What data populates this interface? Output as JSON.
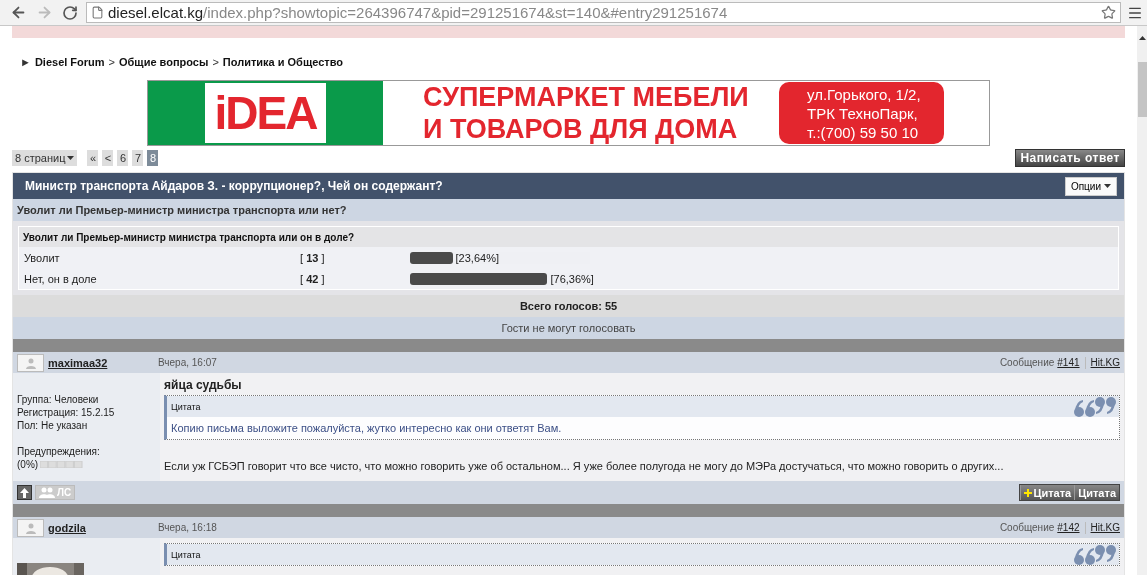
{
  "browser": {
    "url_host": "diesel.elcat.kg",
    "url_path": "/index.php?showtopic=264396747&pid=291251674&st=140&#entry291251674",
    "forward_disabled": true
  },
  "breadcrumb": {
    "marker": "►",
    "separator": ">",
    "items": [
      "Diesel Forum",
      "Общие вопросы",
      "Политика и Общество"
    ]
  },
  "banner": {
    "logo": "iDEA",
    "headline": [
      "СУПЕРМАРКЕТ МЕБЕЛИ",
      "И ТОВАРОВ ДЛЯ ДОМА"
    ],
    "address": [
      "ул.Горького, 1/2,",
      "ТРК ТехноПарк,",
      "т.:(700) 59 50 10"
    ]
  },
  "pagination": {
    "pages_label": "8 страниц",
    "buttons": [
      {
        "label": "«",
        "selected": false
      },
      {
        "label": "<",
        "selected": false
      },
      {
        "label": "6",
        "selected": false
      },
      {
        "label": "7",
        "selected": false
      },
      {
        "label": "8",
        "selected": true
      }
    ]
  },
  "reply_button": "Написать ответ",
  "topic": {
    "title": "Министр транспорта Айдаров З. - коррупционер?, Чей он содержант?",
    "options_button": "Опции",
    "subtitle": "Уволит ли Премьер-министр министра транспорта или нет?"
  },
  "poll": {
    "question": "Уволит ли Премьер-министр министра транспорта или он в доле?",
    "options": [
      {
        "label": "Уволит",
        "votes": "[ **13** ]",
        "level": 0.2364,
        "percent": "[23,64%]"
      },
      {
        "label": "Нет, он в доле",
        "votes": "[ **42** ]",
        "level": 0.7636,
        "percent": "[76,36%]"
      }
    ],
    "total": "Всего голосов: 55",
    "guests_note": "Гости не могут голосовать"
  },
  "posts": [
    {
      "author": "maximaa32",
      "date": "Вчера, 16:07",
      "post_label": "Сообщение",
      "post_number": "#141",
      "site_link": "Hit.KG",
      "avatar": {
        "kind": "placeholder"
      },
      "user_info": [
        "Группа: Человеки",
        "Регистрация: 15.2.15",
        "Пол: Не указан"
      ],
      "warnings_label": "Предупреждения:",
      "warnings_value": "(0%)",
      "title": "яйца судьбы",
      "quote": {
        "label": "Цитата",
        "text": "Копию письма выложите пожалуйста, жутко интересно как они ответят Вам."
      },
      "body": "Если уж ГСБЭП говорит что все чисто, что можно говорить уже об остальном... Я уже более полугода не могу до МЭРа достучаться, что можно говорить о других...",
      "footer": {
        "pm_button": "ЛС",
        "quote_buttons": [
          {
            "kind": "multiquote",
            "label": "Цитата"
          },
          {
            "kind": "quote",
            "label": "Цитата"
          }
        ]
      }
    },
    {
      "author": "godzila",
      "date": "Вчера, 16:18",
      "post_label": "Сообщение",
      "post_number": "#142",
      "site_link": "Hit.KG",
      "quote": {
        "label": "Цитата"
      }
    }
  ]
}
